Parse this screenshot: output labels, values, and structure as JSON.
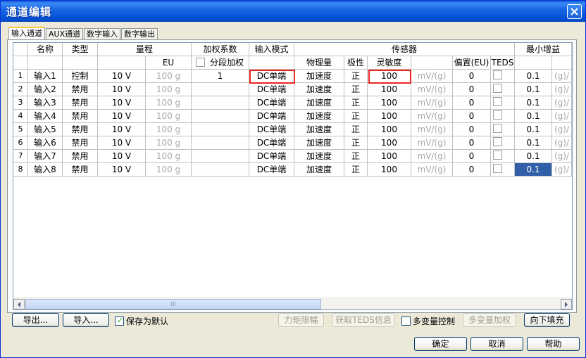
{
  "window": {
    "title": "通道编辑"
  },
  "tabs": [
    {
      "label": "输入通道",
      "active": true
    },
    {
      "label": "AUX通道",
      "active": false
    },
    {
      "label": "数字输入",
      "active": false
    },
    {
      "label": "数字输出",
      "active": false
    }
  ],
  "table": {
    "header_top": {
      "name": "名称",
      "type": "类型",
      "range": "量程",
      "weight": "加权系数",
      "input_mode": "输入模式",
      "sensor": "传感器",
      "min_gain": "最小增益"
    },
    "header_sub": {
      "eu": "EU",
      "segment_weight": "分段加权",
      "phys": "物理量",
      "polarity": "极性",
      "sensitivity": "灵敏度",
      "offset": "偏置(EU)",
      "teds": "TEDS"
    },
    "rows": [
      {
        "index": "1",
        "name": "输入1",
        "type": "控制",
        "range": "10 V",
        "eu": "100 g",
        "weight": "1",
        "mode": "DC单端",
        "phys": "加速度",
        "polarity": "正",
        "sensitivity": "100",
        "sens_unit": "mV/(g)",
        "offset": "0",
        "gain": "0.1",
        "gain_unit": "(g)/"
      },
      {
        "index": "2",
        "name": "输入2",
        "type": "禁用",
        "range": "10 V",
        "eu": "100 g",
        "weight": "",
        "mode": "DC单端",
        "phys": "加速度",
        "polarity": "正",
        "sensitivity": "100",
        "sens_unit": "mV/(g)",
        "offset": "0",
        "gain": "0.1",
        "gain_unit": "(g)/"
      },
      {
        "index": "3",
        "name": "输入3",
        "type": "禁用",
        "range": "10 V",
        "eu": "100 g",
        "weight": "",
        "mode": "DC单端",
        "phys": "加速度",
        "polarity": "正",
        "sensitivity": "100",
        "sens_unit": "mV/(g)",
        "offset": "0",
        "gain": "0.1",
        "gain_unit": "(g)/"
      },
      {
        "index": "4",
        "name": "输入4",
        "type": "禁用",
        "range": "10 V",
        "eu": "100 g",
        "weight": "",
        "mode": "DC单端",
        "phys": "加速度",
        "polarity": "正",
        "sensitivity": "100",
        "sens_unit": "mV/(g)",
        "offset": "0",
        "gain": "0.1",
        "gain_unit": "(g)/"
      },
      {
        "index": "5",
        "name": "输入5",
        "type": "禁用",
        "range": "10 V",
        "eu": "100 g",
        "weight": "",
        "mode": "DC单端",
        "phys": "加速度",
        "polarity": "正",
        "sensitivity": "100",
        "sens_unit": "mV/(g)",
        "offset": "0",
        "gain": "0.1",
        "gain_unit": "(g)/"
      },
      {
        "index": "6",
        "name": "输入6",
        "type": "禁用",
        "range": "10 V",
        "eu": "100 g",
        "weight": "",
        "mode": "DC单端",
        "phys": "加速度",
        "polarity": "正",
        "sensitivity": "100",
        "sens_unit": "mV/(g)",
        "offset": "0",
        "gain": "0.1",
        "gain_unit": "(g)/"
      },
      {
        "index": "7",
        "name": "输入7",
        "type": "禁用",
        "range": "10 V",
        "eu": "100 g",
        "weight": "",
        "mode": "DC单端",
        "phys": "加速度",
        "polarity": "正",
        "sensitivity": "100",
        "sens_unit": "mV/(g)",
        "offset": "0",
        "gain": "0.1",
        "gain_unit": "(g)/"
      },
      {
        "index": "8",
        "name": "输入8",
        "type": "禁用",
        "range": "10 V",
        "eu": "100 g",
        "weight": "",
        "mode": "DC单端",
        "phys": "加速度",
        "polarity": "正",
        "sensitivity": "100",
        "sens_unit": "mV/(g)",
        "offset": "0",
        "gain": "0.1",
        "gain_unit": "(g)/"
      }
    ]
  },
  "scrollbar": {
    "thumb_grip": "III"
  },
  "buttons": {
    "export": "导出...",
    "import": "导入...",
    "save_default": "保存为默认",
    "torque_limit": "力矩限幅",
    "get_teds": "获取TEDS信息",
    "multivar_control": "多变量控制",
    "multivar_weight": "多变量加权",
    "fill_down": "向下填充",
    "ok": "确定",
    "cancel": "取消",
    "help": "帮助"
  },
  "colors": {
    "title_bar": "#0553d6",
    "highlight_box": "#e8281e",
    "selected_cell": "#3260a8"
  }
}
